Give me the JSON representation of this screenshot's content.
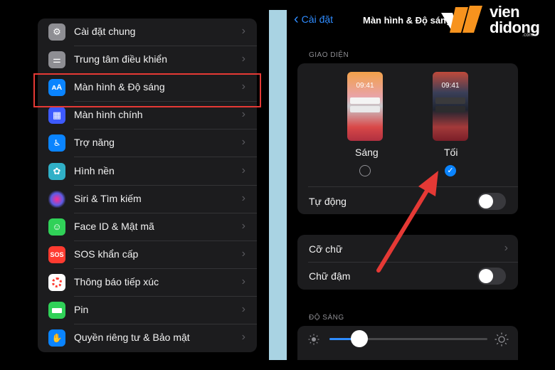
{
  "settings_list": {
    "items": [
      {
        "label": "Cài đặt chung",
        "icon": "gear-icon",
        "color": "#8e8e93"
      },
      {
        "label": "Trung tâm điều khiển",
        "icon": "control-center-icon",
        "color": "#8e8e93"
      },
      {
        "label": "Màn hình & Độ sáng",
        "icon": "display-brightness-icon",
        "color": "#0a84ff"
      },
      {
        "label": "Màn hình chính",
        "icon": "home-screen-icon",
        "color": "#3d5afe"
      },
      {
        "label": "Trợ năng",
        "icon": "accessibility-icon",
        "color": "#0a84ff"
      },
      {
        "label": "Hình nền",
        "icon": "wallpaper-icon",
        "color": "#30b0c7"
      },
      {
        "label": "Siri & Tìm kiếm",
        "icon": "siri-icon",
        "color": "#1c1c1e"
      },
      {
        "label": "Face ID & Mật mã",
        "icon": "face-id-icon",
        "color": "#30d158"
      },
      {
        "label": "SOS khẩn cấp",
        "icon": "sos-icon",
        "color": "#ff3b30",
        "icon_text": "SOS"
      },
      {
        "label": "Thông báo tiếp xúc",
        "icon": "exposure-notification-icon",
        "color": "#ffffff"
      },
      {
        "label": "Pin",
        "icon": "battery-icon",
        "color": "#30d158"
      },
      {
        "label": "Quyền riêng tư & Bảo mật",
        "icon": "privacy-hand-icon",
        "color": "#0a84ff"
      }
    ],
    "icon_text_display": "ᴀA"
  },
  "display_screen": {
    "back_label": "Cài đặt",
    "title": "Màn hình & Độ sáng",
    "appearance_header": "GIAO DIỆN",
    "thumb_time": "09:41",
    "light_label": "Sáng",
    "dark_label": "Tối",
    "selected_mode": "dark",
    "auto_label": "Tự động",
    "auto_enabled": false,
    "text_size_label": "Cỡ chữ",
    "bold_text_label": "Chữ đậm",
    "bold_enabled": false,
    "brightness_header": "ĐỘ SÁNG",
    "brightness_level": 0.19
  },
  "logo": {
    "line1": "vien",
    "line2": "didong",
    "line3": ".com"
  },
  "colors": {
    "accent": "#0a84ff",
    "highlight": "#e53935",
    "arrow": "#e53935",
    "divider": "#a9d3e3"
  }
}
